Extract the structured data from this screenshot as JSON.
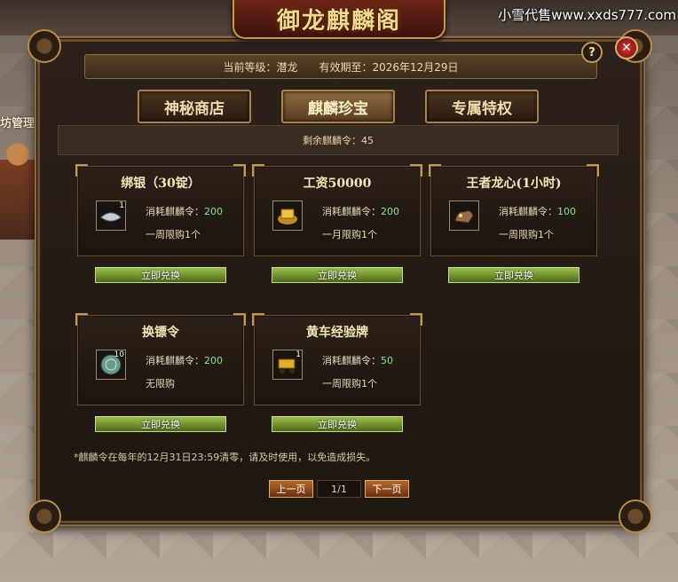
{
  "watermark": "小雪代售www.xxds777.com",
  "background": {
    "sign_text": "坊管理"
  },
  "window": {
    "title": "御龙麒麟阁",
    "level_label": "当前等级：潜龙",
    "expiry_label": "有效期至：2026年12月29日",
    "help_label": "?",
    "close_label": "✕"
  },
  "tabs": [
    {
      "label": "神秘商店",
      "active": false
    },
    {
      "label": "麒麟珍宝",
      "active": true
    },
    {
      "label": "专属特权",
      "active": false
    }
  ],
  "tokens": {
    "label": "剩余麒麟令：45"
  },
  "cost_prefix": "消耗麒麟令：",
  "redeem_label": "立即兑换",
  "items": [
    {
      "name": "绑银（30锭）",
      "count": "1",
      "cost": "200",
      "limit": "一周限购1个",
      "icon": "silver-ingot-icon"
    },
    {
      "name": "工资50000",
      "count": "",
      "cost": "200",
      "limit": "一月限购1个",
      "icon": "gold-icon"
    },
    {
      "name": "王者龙心(1小时)",
      "count": "",
      "cost": "100",
      "limit": "一周限购1个",
      "icon": "dragon-heart-icon"
    },
    {
      "name": "换镖令",
      "count": "10",
      "cost": "200",
      "limit": "无限购",
      "icon": "escort-token-icon"
    },
    {
      "name": "黄车经验牌",
      "count": "1",
      "cost": "50",
      "limit": "一周限购1个",
      "icon": "yellow-cart-icon"
    }
  ],
  "note": "*麒麟令在每年的12月31日23:59清零，请及时使用，以免造成损失。",
  "pager": {
    "prev": "上一页",
    "page": "1/1",
    "next": "下一页"
  }
}
